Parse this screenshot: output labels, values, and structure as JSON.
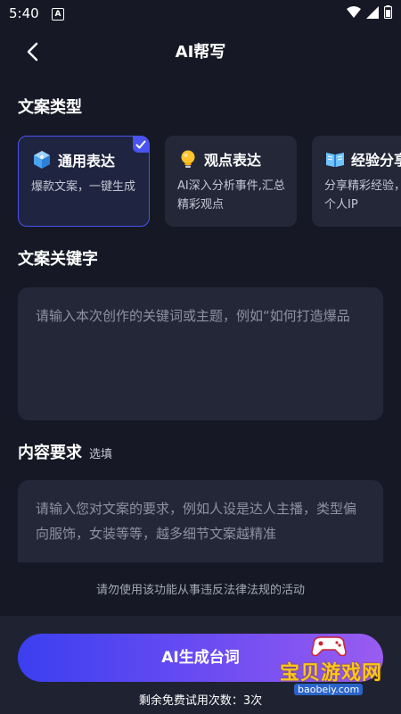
{
  "status": {
    "time": "5:40",
    "notif_icon": "A"
  },
  "header": {
    "title": "AI帮写"
  },
  "type_section": {
    "title": "文案类型",
    "cards": [
      {
        "title": "通用表达",
        "desc": "爆款文案，一键生成",
        "icon": "cube-icon",
        "selected": true
      },
      {
        "title": "观点表达",
        "desc": "AI深入分析事件,汇总精彩观点",
        "icon": "lightbulb-icon",
        "selected": false
      },
      {
        "title": "经验分享",
        "desc": "分享精彩经验，打造个人IP",
        "icon": "book-icon",
        "selected": false
      }
    ]
  },
  "keyword_section": {
    "title": "文案关键字",
    "placeholder": "请输入本次创作的关键词或主题，例如“如何打造爆品"
  },
  "content_section": {
    "title": "内容要求",
    "optional": "选填",
    "placeholder": "请输入您对文案的要求，例如人设是达人主播，类型偏向服饰，女装等等，越多细节文案越精准"
  },
  "warning": "请勿使用该功能从事违反法律法规的活动",
  "generate_button": "AI生成台词",
  "trials_text": "剩余免费试用次数：3次",
  "watermark": {
    "text": "宝贝游戏网",
    "url": "baobeiy.com"
  },
  "colors": {
    "accent": "#4a52f0",
    "background": "#161925",
    "card": "#232738"
  }
}
